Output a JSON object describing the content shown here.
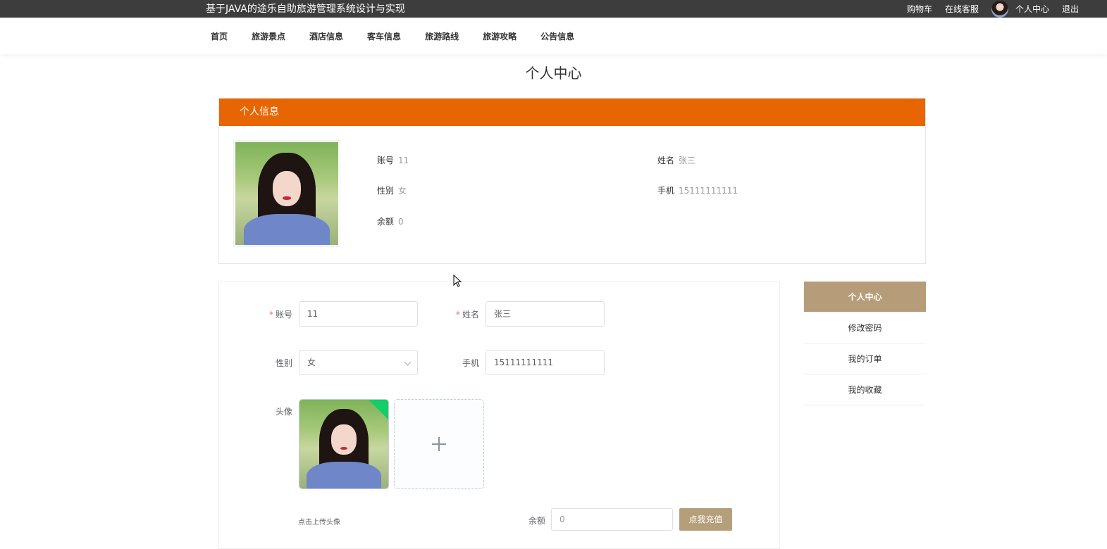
{
  "topbar": {
    "site_title": "基于JAVA的途乐自助旅游管理系统设计与实现",
    "links": {
      "cart": "购物车",
      "service": "在线客服",
      "profile": "个人中心",
      "logout": "退出"
    }
  },
  "nav": {
    "items": [
      "首页",
      "旅游景点",
      "酒店信息",
      "客车信息",
      "旅游路线",
      "旅游攻略",
      "公告信息"
    ]
  },
  "page_title": "个人中心",
  "info_card": {
    "header": "个人信息",
    "fields": {
      "account": {
        "label": "账号",
        "value": "11"
      },
      "name": {
        "label": "姓名",
        "value": "张三"
      },
      "gender": {
        "label": "性别",
        "value": "女"
      },
      "phone": {
        "label": "手机",
        "value": "15111111111"
      },
      "balance": {
        "label": "余额",
        "value": "0"
      }
    }
  },
  "form": {
    "account": {
      "label": "账号",
      "value": "11"
    },
    "name": {
      "label": "姓名",
      "value": "张三"
    },
    "gender": {
      "label": "性别",
      "value": "女"
    },
    "phone": {
      "label": "手机",
      "value": "15111111111"
    },
    "avatar": {
      "label": "头像",
      "hint": "点击上传头像"
    },
    "balance": {
      "label": "余额",
      "value": "0"
    },
    "recharge_button": "点我充值"
  },
  "side_menu": {
    "items": [
      "个人中心",
      "修改密码",
      "我的订单",
      "我的收藏"
    ],
    "active_index": 0
  },
  "colors": {
    "header_orange": "#e86503",
    "accent_tan": "#b69c78",
    "topbar": "#3d3d3d"
  }
}
